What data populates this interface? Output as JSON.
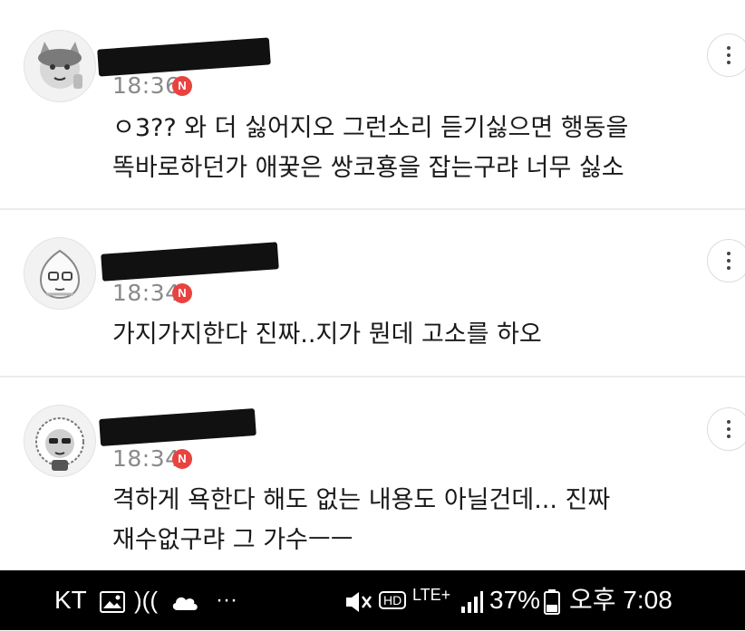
{
  "comments": [
    {
      "time": "18:36",
      "badge": "N",
      "lines": [
        "ㅇ3?? 와 더 싫어지오 그런소리 듣기싫으면 행동을",
        "똑바로하던가 애꿎은 쌍코횽을 잡는구랴 너무 싫소"
      ]
    },
    {
      "time": "18:34",
      "badge": "N",
      "lines": [
        "가지가지한다 진짜..지가 뭔데 고소를 하오"
      ]
    },
    {
      "time": "18:34",
      "badge": "N",
      "lines": [
        "격하게 욕한다 해도 없는 내용도 아닐건데... 진짜",
        "재수없구랴 그 가수ㅡㅡ"
      ]
    }
  ],
  "statusbar": {
    "carrier": "KT",
    "image_icon": "image-icon",
    "sync_icon": "signal-sync-icon",
    "cloud_icon": "cloud-icon",
    "more": "···",
    "mute_icon": "vibrate-mute-icon",
    "hd": "HD",
    "lte": "LTE+",
    "battery_percent": "37%",
    "time": "오후 7:08"
  },
  "colors": {
    "badge": "#e9433f",
    "time_text": "#8a8a8a",
    "divider": "#ebebeb"
  }
}
